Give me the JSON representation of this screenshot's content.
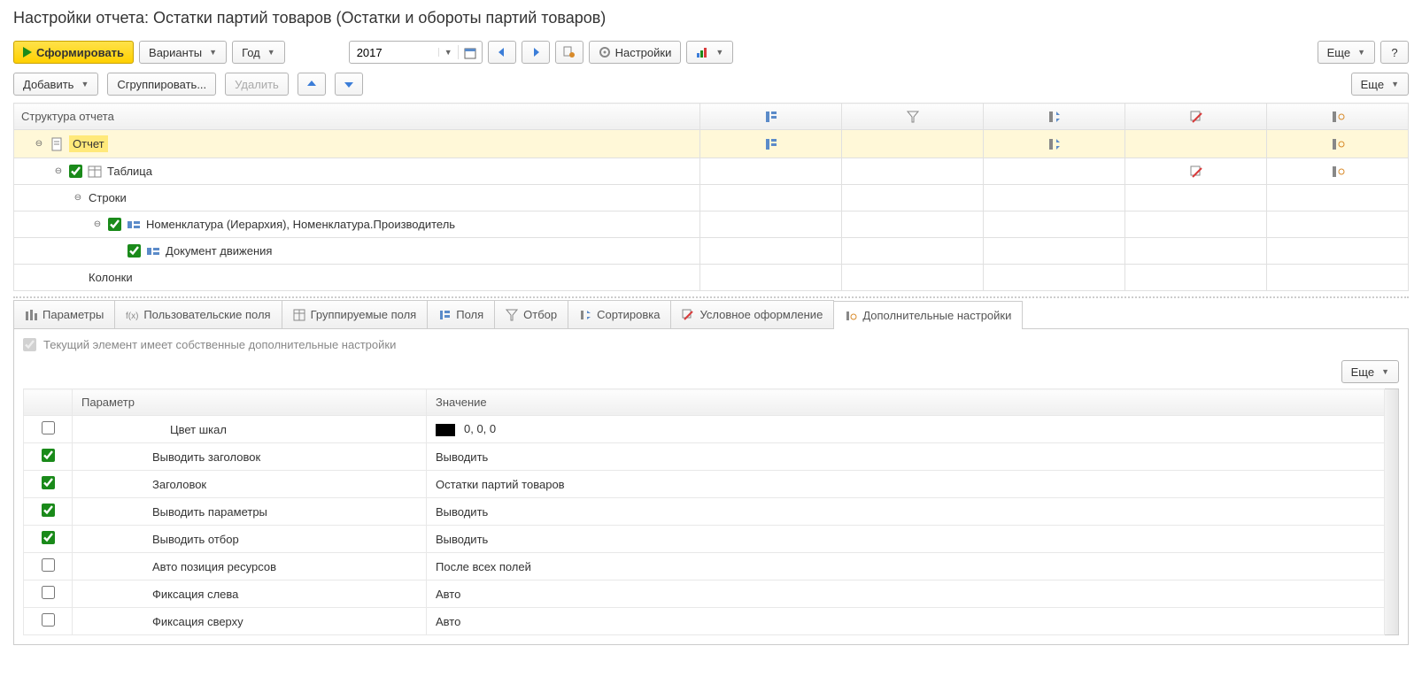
{
  "title": "Настройки отчета: Остатки партий товаров (Остатки и обороты партий товаров)",
  "toolbar": {
    "form": "Сформировать",
    "variants": "Варианты",
    "period_type": "Год",
    "period_value": "2017",
    "settings": "Настройки",
    "more": "Еще",
    "help": "?"
  },
  "subtoolbar": {
    "add": "Добавить",
    "group": "Сгруппировать...",
    "delete": "Удалить",
    "more": "Еще"
  },
  "structure": {
    "header": "Структура отчета",
    "rows": [
      {
        "indent": 0,
        "toggle": true,
        "check": null,
        "icon": "doc",
        "label": "Отчет",
        "selected": true,
        "cols": [
          true,
          false,
          true,
          false,
          true
        ]
      },
      {
        "indent": 1,
        "toggle": true,
        "check": true,
        "icon": "table",
        "label": "Таблица",
        "selected": false,
        "cols": [
          false,
          false,
          false,
          true,
          true
        ]
      },
      {
        "indent": 2,
        "toggle": true,
        "check": null,
        "icon": null,
        "label": "Строки",
        "selected": false,
        "cols": [
          false,
          false,
          false,
          false,
          false
        ]
      },
      {
        "indent": 3,
        "toggle": true,
        "check": true,
        "icon": "group",
        "label": "Номенклатура (Иерархия), Номенклатура.Производитель",
        "selected": false,
        "cols": [
          false,
          false,
          false,
          false,
          false
        ]
      },
      {
        "indent": 4,
        "toggle": false,
        "check": true,
        "icon": "group",
        "label": "Документ движения",
        "selected": false,
        "cols": [
          false,
          false,
          false,
          false,
          false
        ]
      },
      {
        "indent": 2,
        "toggle": false,
        "check": null,
        "icon": null,
        "label": "Колонки",
        "selected": false,
        "cols": [
          false,
          false,
          false,
          false,
          false
        ]
      }
    ]
  },
  "tabs": [
    {
      "icon": "params",
      "label": "Параметры"
    },
    {
      "icon": "userfields",
      "label": "Пользовательские поля"
    },
    {
      "icon": "grouped",
      "label": "Группируемые поля"
    },
    {
      "icon": "fields",
      "label": "Поля"
    },
    {
      "icon": "filter",
      "label": "Отбор"
    },
    {
      "icon": "sort",
      "label": "Сортировка"
    },
    {
      "icon": "condformat",
      "label": "Условное оформление"
    },
    {
      "icon": "extra",
      "label": "Дополнительные настройки"
    }
  ],
  "active_tab": 7,
  "own_settings_label": "Текущий элемент имеет собственные дополнительные настройки",
  "content_more": "Еще",
  "params_table": {
    "col_param": "Параметр",
    "col_value": "Значение",
    "rows": [
      {
        "checked": false,
        "param": "Цвет шкал",
        "value": "0, 0, 0",
        "swatch": true,
        "indent": true
      },
      {
        "checked": true,
        "param": "Выводить заголовок",
        "value": "Выводить"
      },
      {
        "checked": true,
        "param": "Заголовок",
        "value": "Остатки партий товаров"
      },
      {
        "checked": true,
        "param": "Выводить параметры",
        "value": "Выводить"
      },
      {
        "checked": true,
        "param": "Выводить отбор",
        "value": "Выводить"
      },
      {
        "checked": false,
        "param": "Авто позиция ресурсов",
        "value": "После всех полей"
      },
      {
        "checked": false,
        "param": "Фиксация слева",
        "value": "Авто"
      },
      {
        "checked": false,
        "param": "Фиксация сверху",
        "value": "Авто"
      }
    ]
  }
}
